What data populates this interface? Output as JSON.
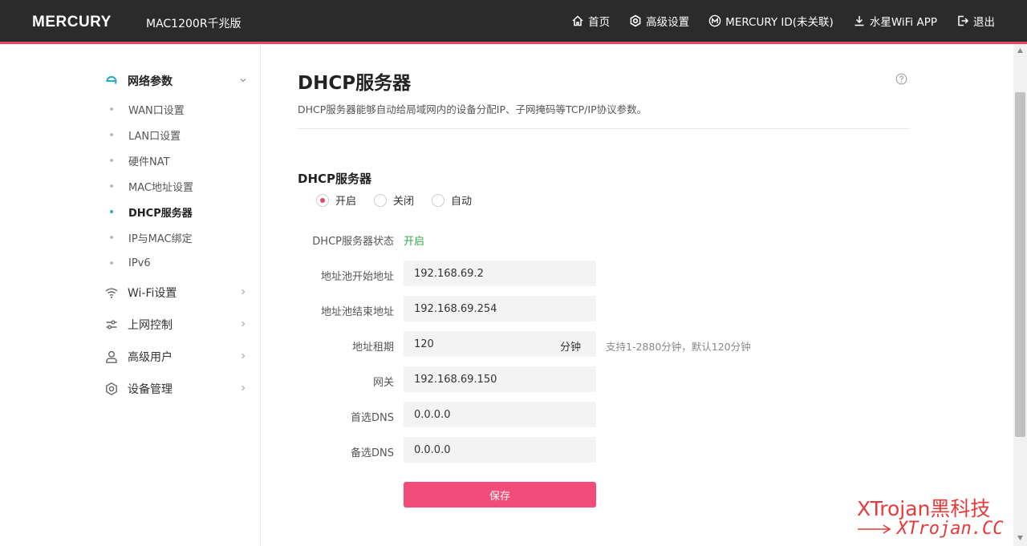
{
  "header": {
    "brand": "MERCURY",
    "model": "MAC1200R千兆版",
    "nav": [
      {
        "label": "首页",
        "icon": "home-icon"
      },
      {
        "label": "高级设置",
        "icon": "settings-icon"
      },
      {
        "label": "MERCURY ID(未关联)",
        "icon": "mercury-id-icon"
      },
      {
        "label": "水星WiFi APP",
        "icon": "download-icon"
      },
      {
        "label": "退出",
        "icon": "logout-icon"
      }
    ]
  },
  "sidebar": {
    "groups": [
      {
        "label": "网络参数",
        "icon": "network-icon",
        "active": true
      },
      {
        "label": "Wi-Fi设置",
        "icon": "wifi-icon"
      },
      {
        "label": "上网控制",
        "icon": "sliders-icon"
      },
      {
        "label": "高级用户",
        "icon": "user-icon"
      },
      {
        "label": "设备管理",
        "icon": "gear-icon"
      }
    ],
    "subitems": [
      "WAN口设置",
      "LAN口设置",
      "硬件NAT",
      "MAC地址设置",
      "DHCP服务器",
      "IP与MAC绑定",
      "IPv6"
    ],
    "active_subitem": "DHCP服务器"
  },
  "main": {
    "title": "DHCP服务器",
    "description": "DHCP服务器能够自动给局域网内的设备分配IP、子网掩码等TCP/IP协议参数。",
    "section_title": "DHCP服务器",
    "radios": [
      {
        "label": "开启",
        "checked": true
      },
      {
        "label": "关闭",
        "checked": false
      },
      {
        "label": "自动",
        "checked": false
      }
    ],
    "status_label": "DHCP服务器状态",
    "status_value": "开启",
    "fields": {
      "pool_start": {
        "label": "地址池开始地址",
        "value": "192.168.69.2"
      },
      "pool_end": {
        "label": "地址池结束地址",
        "value": "192.168.69.254"
      },
      "lease": {
        "label": "地址租期",
        "value": "120",
        "unit": "分钟",
        "hint": "支持1-2880分钟，默认120分钟"
      },
      "gateway": {
        "label": "网关",
        "value": "192.168.69.150"
      },
      "dns1": {
        "label": "首选DNS",
        "value": "0.0.0.0"
      },
      "dns2": {
        "label": "备选DNS",
        "value": "0.0.0.0"
      }
    },
    "save_label": "保存"
  },
  "watermark": {
    "line1": "XTrojan黑科技",
    "line2": "XTrojan.CC"
  },
  "colors": {
    "accent": "#e8466b",
    "save_button": "#f24d78",
    "status_on": "#2faa4a",
    "header_bg": "#2b2b2b",
    "active_dot": "#29a8c9"
  }
}
